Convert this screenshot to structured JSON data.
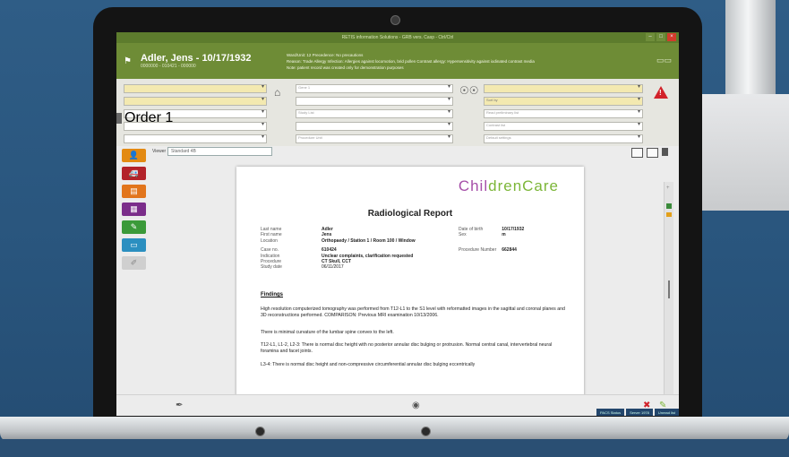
{
  "app": {
    "title": "RETIS information Solutions - GRB vers. Casp - Ctrl/Ctrl",
    "window_buttons": [
      "–",
      "□",
      "×"
    ]
  },
  "patient": {
    "name": "Adler, Jens - 10/17/1932",
    "sub": "0000000 - 010421 - 000000",
    "info_line1": "Ward/Unit: 12 Precedence: No precautions",
    "info_line2": "Reason: Trade Allergy Infection: Allergies against locomotion, brid pollen Contrast allergy: Hypersensitivity against iodinated contrast media",
    "info_line3": "Note: patient record was created only for demonstration purposes"
  },
  "filters": {
    "col1": [
      "",
      "",
      "Order 1",
      "",
      ""
    ],
    "col2": [
      "Gene 1",
      "",
      "Study List",
      "",
      "Procedure Unit"
    ],
    "col3": [
      "",
      "Sort by",
      "Read preliminary list",
      "Contrast list",
      "Default settings"
    ]
  },
  "viewer": {
    "label": "Viewer",
    "select_value": "Standard 4B"
  },
  "report": {
    "logo_left": "Chil",
    "logo_right": "drenCare",
    "title": "Radiological Report",
    "meta": [
      {
        "k": "Last name",
        "v": "Adler"
      },
      {
        "k": "First name",
        "v": "Jens"
      },
      {
        "k": "Location",
        "v": "Orthopaedy / Station 1 / Room 100 / Window"
      },
      {
        "k": "Case no.",
        "v": "610424"
      },
      {
        "k": "Indication",
        "v": "Unclear complaints, clarification requested"
      },
      {
        "k": "Procedure",
        "v": "CT Skull, CCT"
      },
      {
        "k": "Study date",
        "v": "06/11/2017"
      }
    ],
    "meta_right": [
      {
        "k": "Date of birth",
        "v": "10/17/1932"
      },
      {
        "k": "Sex",
        "v": "m"
      },
      {
        "k": "Procedure Number",
        "v": "662844"
      }
    ],
    "findings_heading": "Findings",
    "paragraphs": [
      "High resolution computerized tomography was performed from T12-L1 to the S1 level with reformatted images in the sagittal and coronal planes and 3D reconstructions performed. COMPARISON: Previous MRI examination 10/13/2006.",
      "There is minimal curvature of the lumbar spine convex to the left.",
      "T12-L1, L1-2, L2-3: There is normal disc height with no posterior annular disc bulging or protrusion. Normal central canal, intervertebral neural foramina and facet joints.",
      "L3-4: There is normal disc height and non-compressive circumferential annular disc bulging eccentrically"
    ]
  },
  "status_bar": [
    "PACS Status",
    "Server 1978",
    "Unread list"
  ],
  "colors": {
    "title_bar": "#5d7c2d",
    "patient_bar": "#6e8c36",
    "warning": "#d2222a",
    "logo_purple": "#a64fa8",
    "logo_green": "#7cb638"
  }
}
